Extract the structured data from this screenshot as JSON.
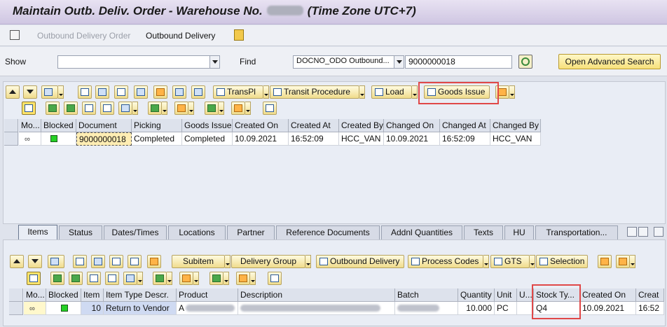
{
  "window": {
    "title_prefix": "Maintain Outb. Deliv. Order - Warehouse No.",
    "title_suffix": "(Time Zone UTC+7)"
  },
  "menu": {
    "item1": "Outbound Delivery Order",
    "item2": "Outbound Delivery"
  },
  "search": {
    "show_label": "Show",
    "show_value": "",
    "find_label": "Find",
    "find_type_value": "DOCNO_ODO Outbound...",
    "find_value": "9000000018",
    "advanced_label": "Open Advanced Search"
  },
  "toolbar1": {
    "transpl": "TransPl",
    "transit_procedure": "Transit Procedure",
    "load": "Load",
    "goods_issue": "Goods Issue"
  },
  "grid1": {
    "headers": [
      "Mo...",
      "Blocked",
      "Document",
      "Picking",
      "Goods Issue",
      "Created On",
      "Created At",
      "Created By",
      "Changed On",
      "Changed At",
      "Changed By"
    ],
    "row": {
      "document": "9000000018",
      "picking": "Completed",
      "goods_issue": "Completed",
      "created_on": "10.09.2021",
      "created_at": "16:52:09",
      "created_by": "HCC_VAN",
      "changed_on": "10.09.2021",
      "changed_at": "16:52:09",
      "changed_by": "HCC_VAN"
    }
  },
  "tabs": [
    "Items",
    "Status",
    "Dates/Times",
    "Locations",
    "Partner",
    "Reference Documents",
    "Addnl Quantities",
    "Texts",
    "HU",
    "Transportation..."
  ],
  "toolbar2": {
    "subitem": "Subitem",
    "delivery_group": "Delivery Group",
    "outbound_delivery": "Outbound Delivery",
    "process_codes": "Process Codes",
    "gts": "GTS",
    "selection": "Selection"
  },
  "grid2": {
    "headers": [
      "Mo...",
      "Blocked",
      "Item",
      "Item Type Descr.",
      "Product",
      "Description",
      "Batch",
      "Quantity",
      "Unit",
      "U...",
      "Stock Ty...",
      "Created On",
      "Creat"
    ],
    "row": {
      "item": "10",
      "item_type_descr": "Return to Vendor",
      "product_prefix": "A",
      "quantity": "10.000",
      "unit": "PC",
      "stock_type": "Q4",
      "created_on": "10.09.2021",
      "created_at": "16:52"
    }
  },
  "colors": {
    "highlight": "#e04848",
    "button": "#f0dc8c",
    "key_column": "#cfdaf2"
  }
}
